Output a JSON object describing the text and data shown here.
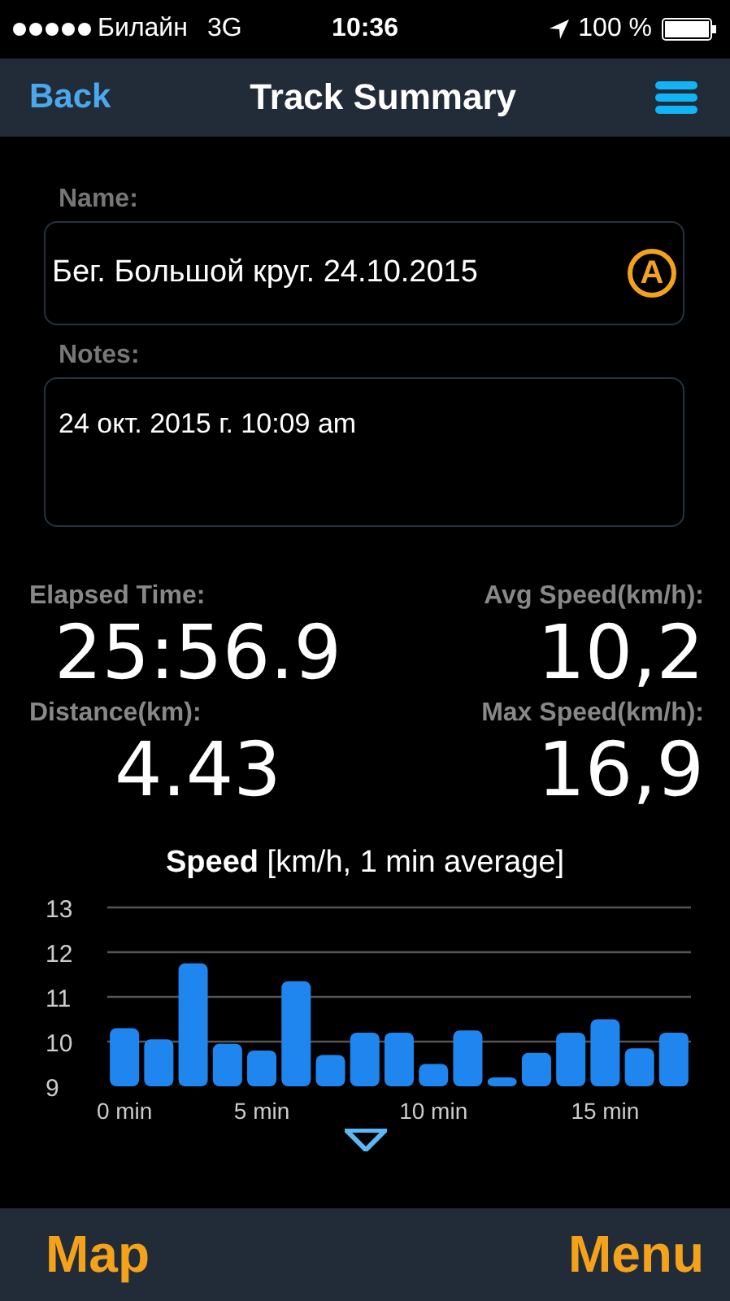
{
  "status_bar": {
    "carrier": "Билайн",
    "network": "3G",
    "time": "10:36",
    "battery": "100 %"
  },
  "nav_bar": {
    "back": "Back",
    "title": "Track Summary"
  },
  "name_field": {
    "label": "Name:",
    "value": "Бег. Большой круг. 24.10.2015",
    "badge": "A"
  },
  "notes_field": {
    "label": "Notes:",
    "value": "24 окт. 2015 г. 10:09 am"
  },
  "stats": [
    {
      "label": "Elapsed Time:",
      "value": "25:56.9"
    },
    {
      "label": "Avg Speed(km/h):",
      "value": "10,2"
    },
    {
      "label": "Distance(km):",
      "value": "4.43"
    },
    {
      "label": "Max Speed(km/h):",
      "value": "16,9"
    }
  ],
  "chart": {
    "chart_data": {
      "type": "bar",
      "title": "**Speed** [km/h, 1 min average]",
      "categories": [
        "0 min",
        null,
        null,
        null,
        "5 min",
        null,
        null,
        null,
        null,
        "10 min",
        null,
        null,
        null,
        null,
        "15 min",
        null,
        null
      ],
      "series": [
        {
          "color": "#1f86f0",
          "values": [
            10.3,
            10.05,
            11.75,
            9.95,
            9.8,
            11.35,
            9.7,
            10.2,
            10.2,
            9.5,
            10.25,
            9.2,
            9.75,
            10.2,
            10.5,
            9.85,
            10.2
          ]
        }
      ],
      "grid": true,
      "ylim": [
        9,
        13
      ],
      "yticks": [
        9,
        10,
        11,
        12,
        13
      ]
    }
  },
  "bottom_bar": {
    "left": "Map",
    "right": "Menu"
  }
}
